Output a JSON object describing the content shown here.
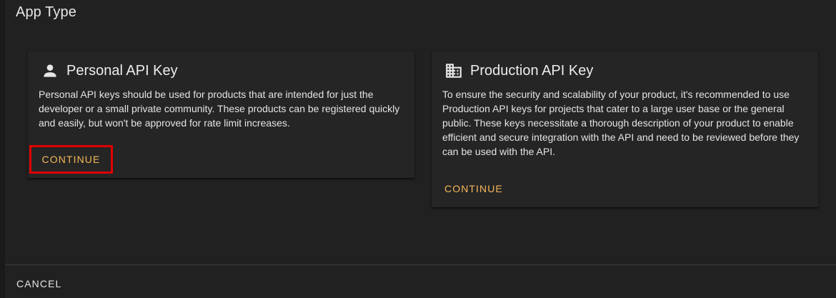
{
  "dialog": {
    "title": "App Type",
    "cancel_label": "CANCEL"
  },
  "cards": [
    {
      "icon": "person-icon",
      "title": "Personal API Key",
      "description": "Personal API keys should be used for products that are intended for just the developer or a small private community. These products can be registered quickly and easily, but won't be approved for rate limit increases.",
      "button_label": "CONTINUE",
      "highlighted": true
    },
    {
      "icon": "building-icon",
      "title": "Production API Key",
      "description": "To ensure the security and scalability of your product, it's recommended to use Production API keys for projects that cater to a large user base or the general public. These keys necessitate a thorough description of your product to enable efficient and secure integration with the API and need to be reviewed before they can be used with the API.",
      "button_label": "CONTINUE",
      "highlighted": false
    }
  ],
  "colors": {
    "accent": "#f5b85a",
    "highlight_border": "#e00000",
    "card_bg": "#252525",
    "dialog_bg": "#212121"
  }
}
